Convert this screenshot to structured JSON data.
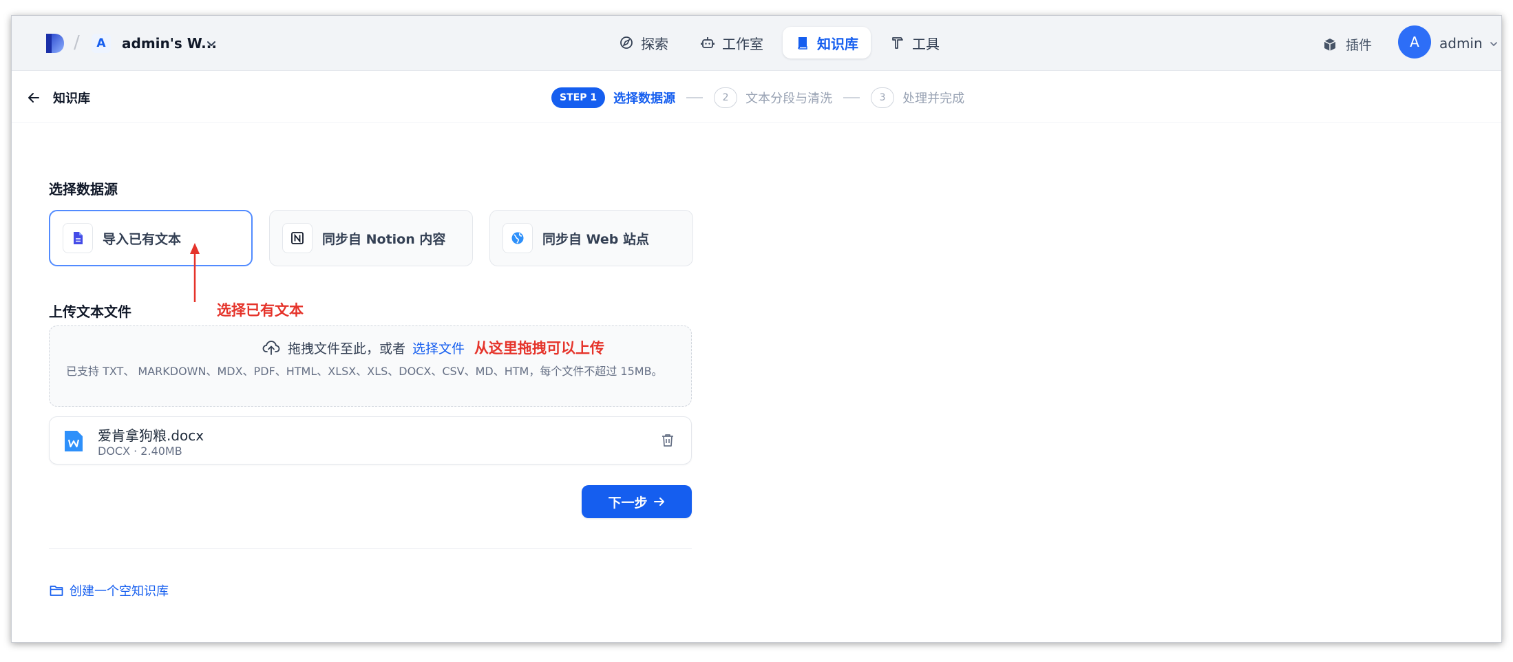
{
  "header": {
    "workspace_initial": "A",
    "workspace_name": "admin's W...",
    "nav": [
      {
        "label": "探索",
        "icon": "compass-icon"
      },
      {
        "label": "工作室",
        "icon": "robot-icon"
      },
      {
        "label": "知识库",
        "icon": "book-icon",
        "active": true
      },
      {
        "label": "工具",
        "icon": "hammer-icon"
      }
    ],
    "plugin_label": "插件",
    "user_initial": "A",
    "user_name": "admin"
  },
  "steps": {
    "back_label": "知识库",
    "step1_pill": "STEP 1",
    "step1_label": "选择数据源",
    "step2_num": "2",
    "step2_label": "文本分段与清洗",
    "step3_num": "3",
    "step3_label": "处理并完成"
  },
  "main": {
    "source_title": "选择数据源",
    "sources": [
      {
        "label": "导入已有文本",
        "icon": "document-icon",
        "selected": true
      },
      {
        "label": "同步自 Notion 内容",
        "icon": "notion-icon"
      },
      {
        "label": "同步自 Web 站点",
        "icon": "globe-icon"
      }
    ],
    "annotation_select": "选择已有文本",
    "upload_title": "上传文本文件",
    "dropzone_text": "拖拽文件至此，或者",
    "dropzone_link": "选择文件",
    "annotation_drag": "从这里拖拽可以上传",
    "dropzone_hint": "已支持 TXT、 MARKDOWN、MDX、PDF、HTML、XLSX、XLS、DOCX、CSV、MD、HTM，每个文件不超过 15MB。",
    "file": {
      "name": "爱肯拿狗粮.docx",
      "meta": "DOCX · 2.40MB"
    },
    "next_label": "下一步",
    "empty_kb_label": "创建一个空知识库"
  },
  "colors": {
    "accent": "#155eef",
    "annotation": "#e5332a"
  }
}
